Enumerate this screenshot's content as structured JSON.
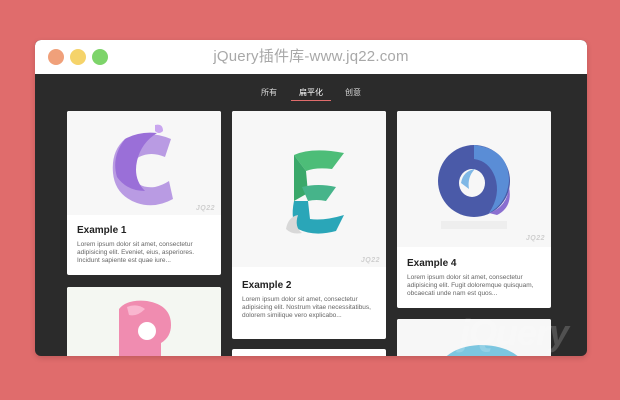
{
  "window": {
    "title": "jQuery插件库-www.jq22.com"
  },
  "tabs": [
    {
      "label": "所有"
    },
    {
      "label": "扁平化"
    },
    {
      "label": "创意"
    }
  ],
  "cards": [
    {
      "title": "Example 1",
      "text": "Lorem ipsum dolor sit amet, consectetur adipisicing elit. Eveniet, eius, asperiores. Incidunt sapiente est quae iure...",
      "watermark": "JQ22"
    },
    {
      "title": "Example 2",
      "text": "Lorem ipsum dolor sit amet, consectetur adipisicing elit. Nostrum vitae necessitatibus, dolorem similique vero explicabo...",
      "watermark": "JQ22"
    },
    {
      "title": "Example 4",
      "text": "Lorem ipsum dolor sit amet, consectetur adipisicing elit. Fugit doloremque quisquam, obcaecati unde nam est quos...",
      "watermark": "JQ22"
    }
  ],
  "watermark_big": "jQuery",
  "colors": {
    "background": "#e06c6c",
    "panel": "#2b2b2b",
    "accent": "#e06c6c"
  }
}
